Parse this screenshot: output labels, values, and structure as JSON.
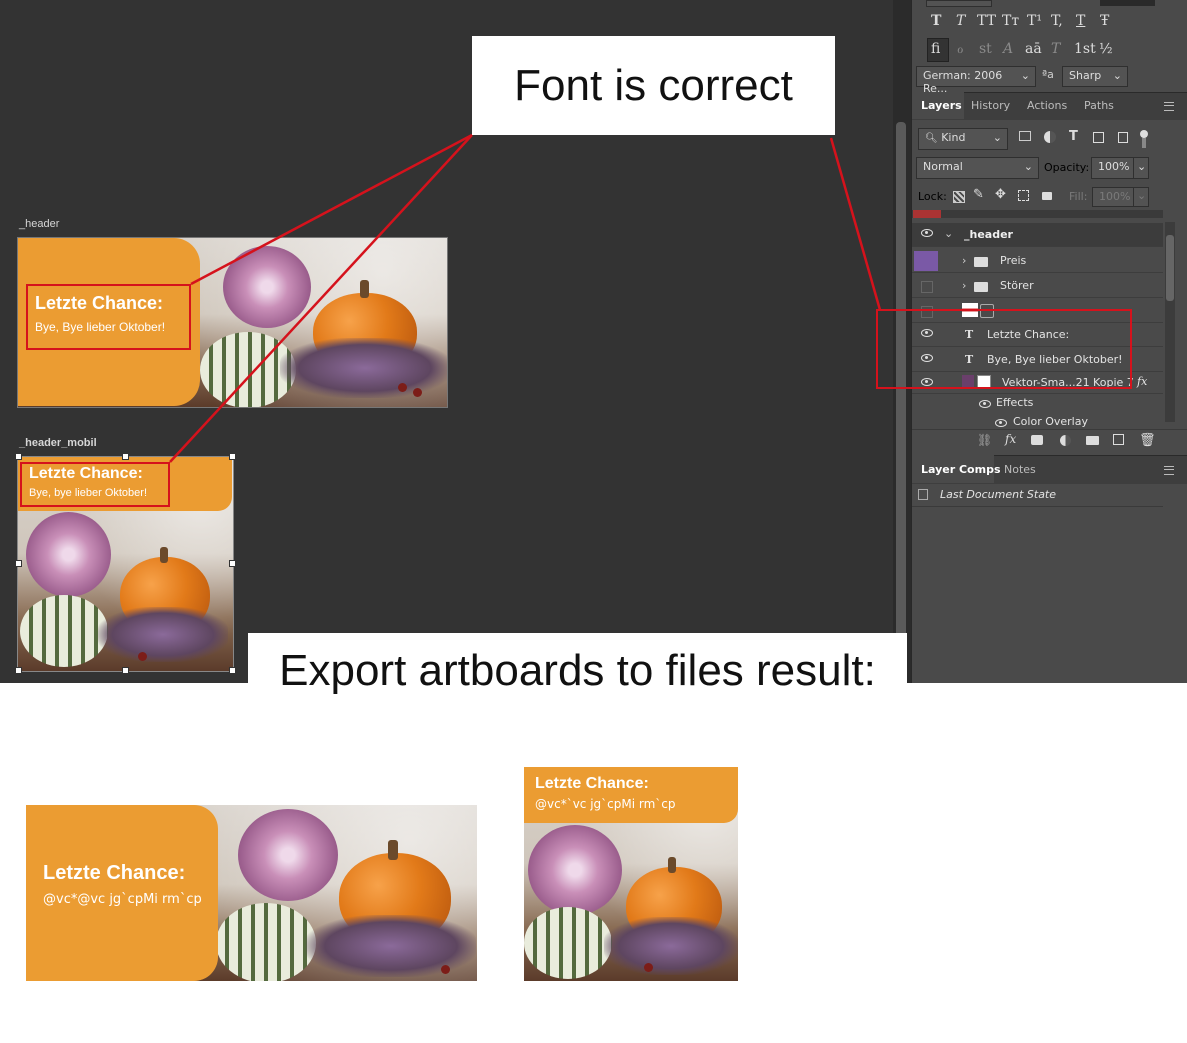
{
  "callouts": {
    "top": "Font is correct",
    "bottom": "Export artboards to files result:"
  },
  "artboards": {
    "header": {
      "label": "_header",
      "title": "Letzte Chance:",
      "subtitle": "Bye, Bye lieber Oktober!"
    },
    "mobile": {
      "label": "_header_mobil",
      "title": "Letzte Chance:",
      "subtitle": "Bye, bye lieber Oktober!"
    }
  },
  "exports": {
    "desktop": {
      "title": "Letzte Chance:",
      "subtitle": "@vc*@vc jg`cpMi rm`cp"
    },
    "mobile": {
      "title": "Letzte Chance:",
      "subtitle": "@vc*`vc jg`cpMi rm`cp"
    }
  },
  "character_panel": {
    "style_glyphs_row1": [
      "T",
      "T",
      "TT",
      "Tт",
      "T¹",
      "T,",
      "T",
      "Ŧ"
    ],
    "style_glyphs_row2": [
      "fi",
      "ℴ",
      "st",
      "A",
      "aā",
      "T",
      "1st",
      "½"
    ],
    "language": "German: 2006 Re...",
    "aa_label": "ªa",
    "antialias": "Sharp"
  },
  "layers_panel": {
    "tabs": [
      "Layers",
      "History",
      "Actions",
      "Paths"
    ],
    "filter_kind": "Kind",
    "blend_mode": "Normal",
    "opacity_label": "Opacity:",
    "opacity_value": "100%",
    "lock_label": "Lock:",
    "fill_label": "Fill:",
    "fill_value": "100%",
    "layers": [
      {
        "name": "_header"
      },
      {
        "name": "Preis"
      },
      {
        "name": "Störer"
      },
      {
        "name": "Letzte Chance:"
      },
      {
        "name": "Bye, Bye lieber Oktober!"
      },
      {
        "name": "Vektor-Sma...21 Kopie 7"
      },
      {
        "name": "Effects"
      },
      {
        "name": "Color Overlay"
      }
    ],
    "fx_label": "fx"
  },
  "comps_panel": {
    "tabs": [
      "Layer Comps",
      "Notes"
    ],
    "state": "Last Document State"
  },
  "colors": {
    "canvas": "#333333",
    "panel": "#4a4a4a",
    "orange": "#eb9c32",
    "highlight_red": "#d5121c"
  }
}
